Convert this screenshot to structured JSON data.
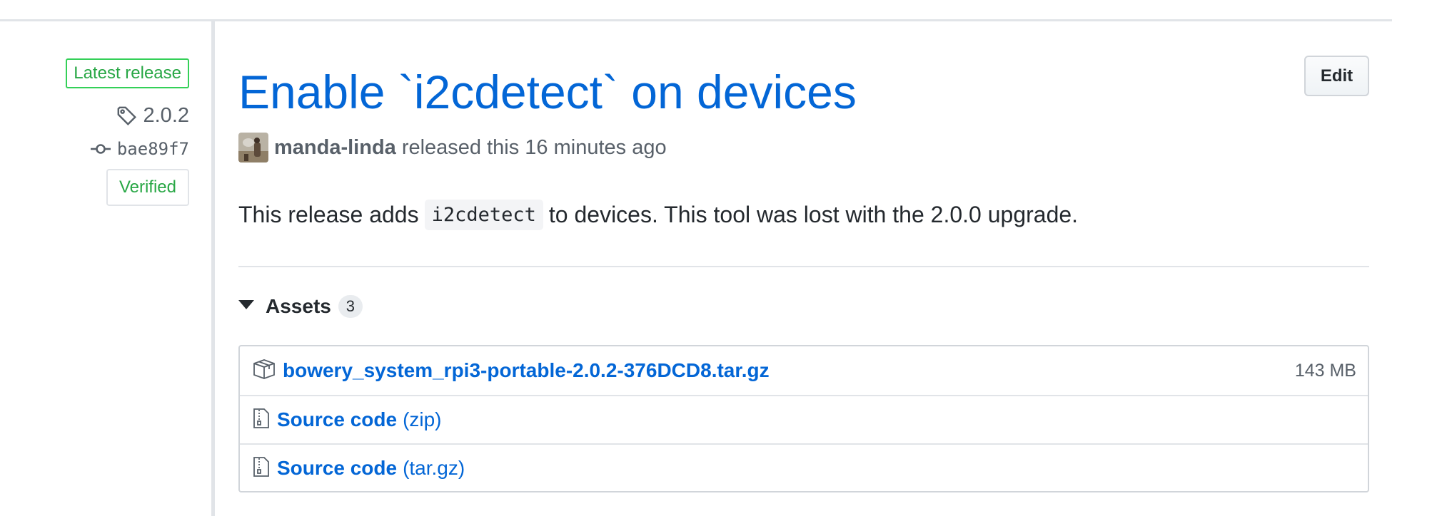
{
  "sidebar": {
    "latest_label": "Latest release",
    "tag": "2.0.2",
    "commit": "bae89f7",
    "verified": "Verified",
    "icons": [
      "tag-icon",
      "git-commit-icon"
    ]
  },
  "release": {
    "title": "Enable `i2cdetect` on devices",
    "edit_label": "Edit",
    "author": "manda-linda",
    "released_text": "released this 16 minutes ago",
    "body": {
      "before": "This release adds",
      "code": "i2cdetect",
      "after": "to devices. This tool was lost with the 2.0.0 upgrade."
    }
  },
  "assets": {
    "heading": "Assets",
    "count": "3",
    "items": [
      {
        "name": "bowery_system_rpi3-portable-2.0.2-376DCD8.tar.gz",
        "suffix": "",
        "size": "143 MB",
        "icon": "package-icon"
      },
      {
        "name": "Source code",
        "suffix": "(zip)",
        "size": "",
        "icon": "file-zip-icon"
      },
      {
        "name": "Source code",
        "suffix": "(tar.gz)",
        "size": "",
        "icon": "file-zip-icon"
      }
    ]
  },
  "colors": {
    "link": "#0366d6",
    "success": "#28a745",
    "muted": "#586069",
    "border": "#e1e4e8"
  }
}
